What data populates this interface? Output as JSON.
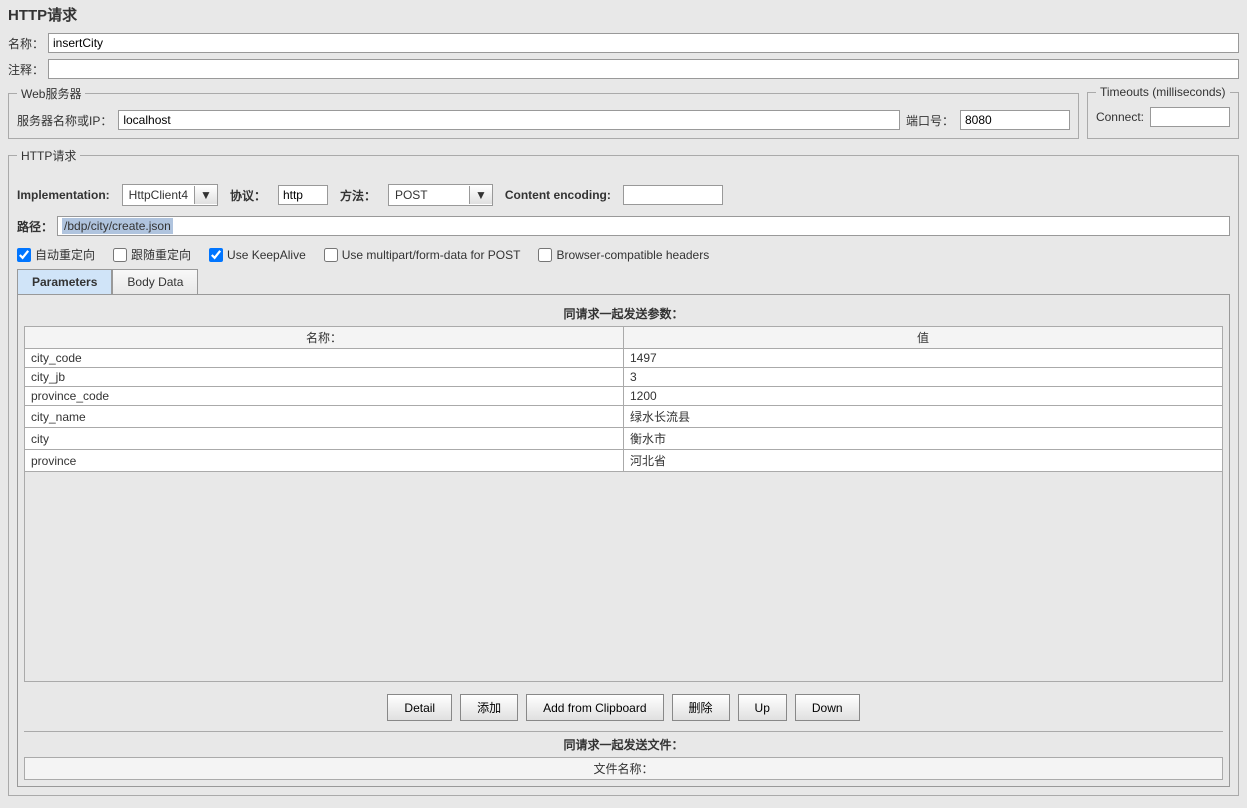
{
  "page_title": "HTTP请求",
  "name_label": "名称：",
  "name_value": "insertCity",
  "comment_label": "注释：",
  "comment_value": "",
  "web_server": {
    "legend": "Web服务器",
    "server_label": "服务器名称或IP：",
    "server_value": "localhost",
    "port_label": "端口号：",
    "port_value": "8080"
  },
  "timeouts": {
    "legend": "Timeouts (milliseconds)",
    "connect_label": "Connect:",
    "connect_value": ""
  },
  "http_req": {
    "legend": "HTTP请求",
    "impl_label": "Implementation:",
    "impl_value": "HttpClient4",
    "protocol_label": "协议：",
    "protocol_value": "http",
    "method_label": "方法：",
    "method_value": "POST",
    "encoding_label": "Content encoding:",
    "encoding_value": "",
    "path_label": "路径：",
    "path_value": "/bdp/city/create.json",
    "chk_auto_redirect": "自动重定向",
    "chk_follow_redirect": "跟随重定向",
    "chk_keepalive": "Use KeepAlive",
    "chk_multipart": "Use multipart/form-data for POST",
    "chk_browser_headers": "Browser-compatible headers"
  },
  "tabs": {
    "parameters": "Parameters",
    "body_data": "Body Data"
  },
  "params_title": "同请求一起发送参数：",
  "params_headers": {
    "name": "名称：",
    "value": "值"
  },
  "params_rows": [
    {
      "name": "city_code",
      "value": "1497"
    },
    {
      "name": "city_jb",
      "value": "3"
    },
    {
      "name": "province_code",
      "value": "1200"
    },
    {
      "name": "city_name",
      "value": "绿水长流县"
    },
    {
      "name": "city",
      "value": "衡水市"
    },
    {
      "name": "province",
      "value": "河北省"
    }
  ],
  "buttons": {
    "detail": "Detail",
    "add": "添加",
    "clipboard": "Add from Clipboard",
    "delete": "删除",
    "up": "Up",
    "down": "Down"
  },
  "files_title": "同请求一起发送文件：",
  "file_header": "文件名称："
}
